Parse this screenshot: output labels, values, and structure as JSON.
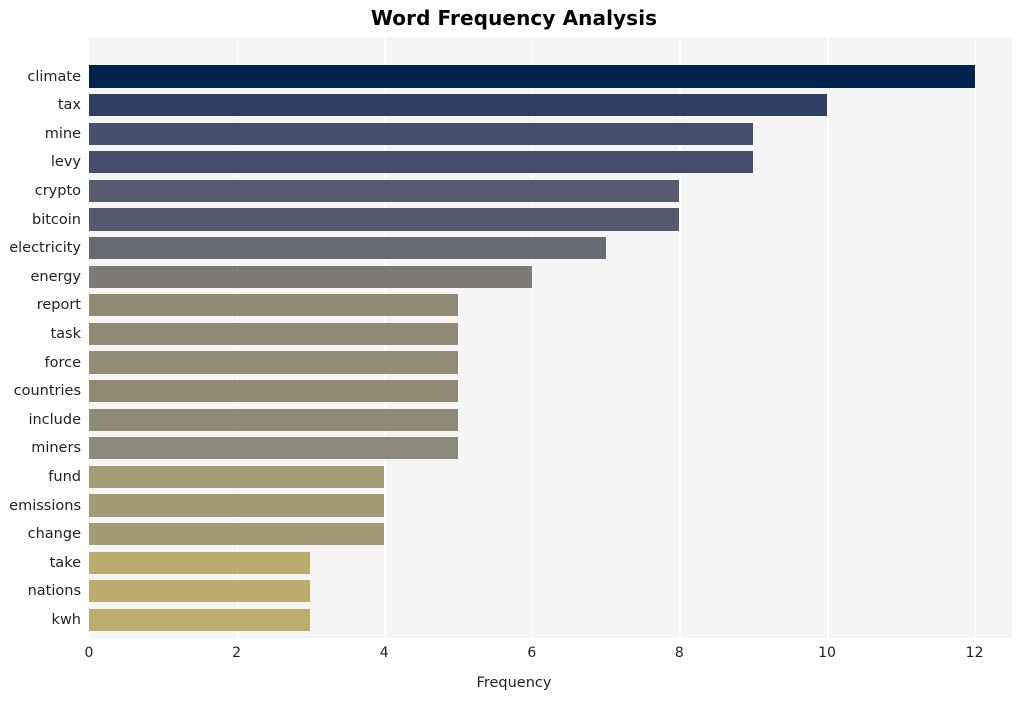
{
  "chart_data": {
    "type": "bar",
    "orientation": "horizontal",
    "title": "Word Frequency Analysis",
    "xlabel": "Frequency",
    "ylabel": "",
    "categories": [
      "climate",
      "tax",
      "mine",
      "levy",
      "crypto",
      "bitcoin",
      "electricity",
      "energy",
      "report",
      "task",
      "force",
      "countries",
      "include",
      "miners",
      "fund",
      "emissions",
      "change",
      "take",
      "nations",
      "kwh"
    ],
    "values": [
      12,
      10,
      9,
      9,
      8,
      8,
      7,
      6,
      5,
      5,
      5,
      5,
      5,
      5,
      4,
      4,
      4,
      3,
      3,
      3
    ],
    "bar_colors": [
      "#00224e",
      "#2f3d63",
      "#464f6b",
      "#454e6d",
      "#565c6e",
      "#535a6d",
      "#676a72",
      "#7c7b77",
      "#908a74",
      "#918b75",
      "#928c76",
      "#908a74",
      "#8e8a78",
      "#8d8a7a",
      "#a39c74",
      "#a29b73",
      "#a29b73",
      "#bbad6d",
      "#bbad6d",
      "#bcae6e"
    ],
    "xlim": [
      0,
      12.5
    ],
    "xticks": [
      0,
      2,
      4,
      6,
      8,
      10,
      12
    ],
    "xtick_labels": [
      "0",
      "2",
      "4",
      "6",
      "8",
      "10",
      "12"
    ],
    "grid": true,
    "grid_axis": "x",
    "grid_color": "#ffffff",
    "plot_background": "#f5f5f6",
    "figure_background": "#ffffff",
    "legend": null,
    "colormap": "cividis"
  }
}
